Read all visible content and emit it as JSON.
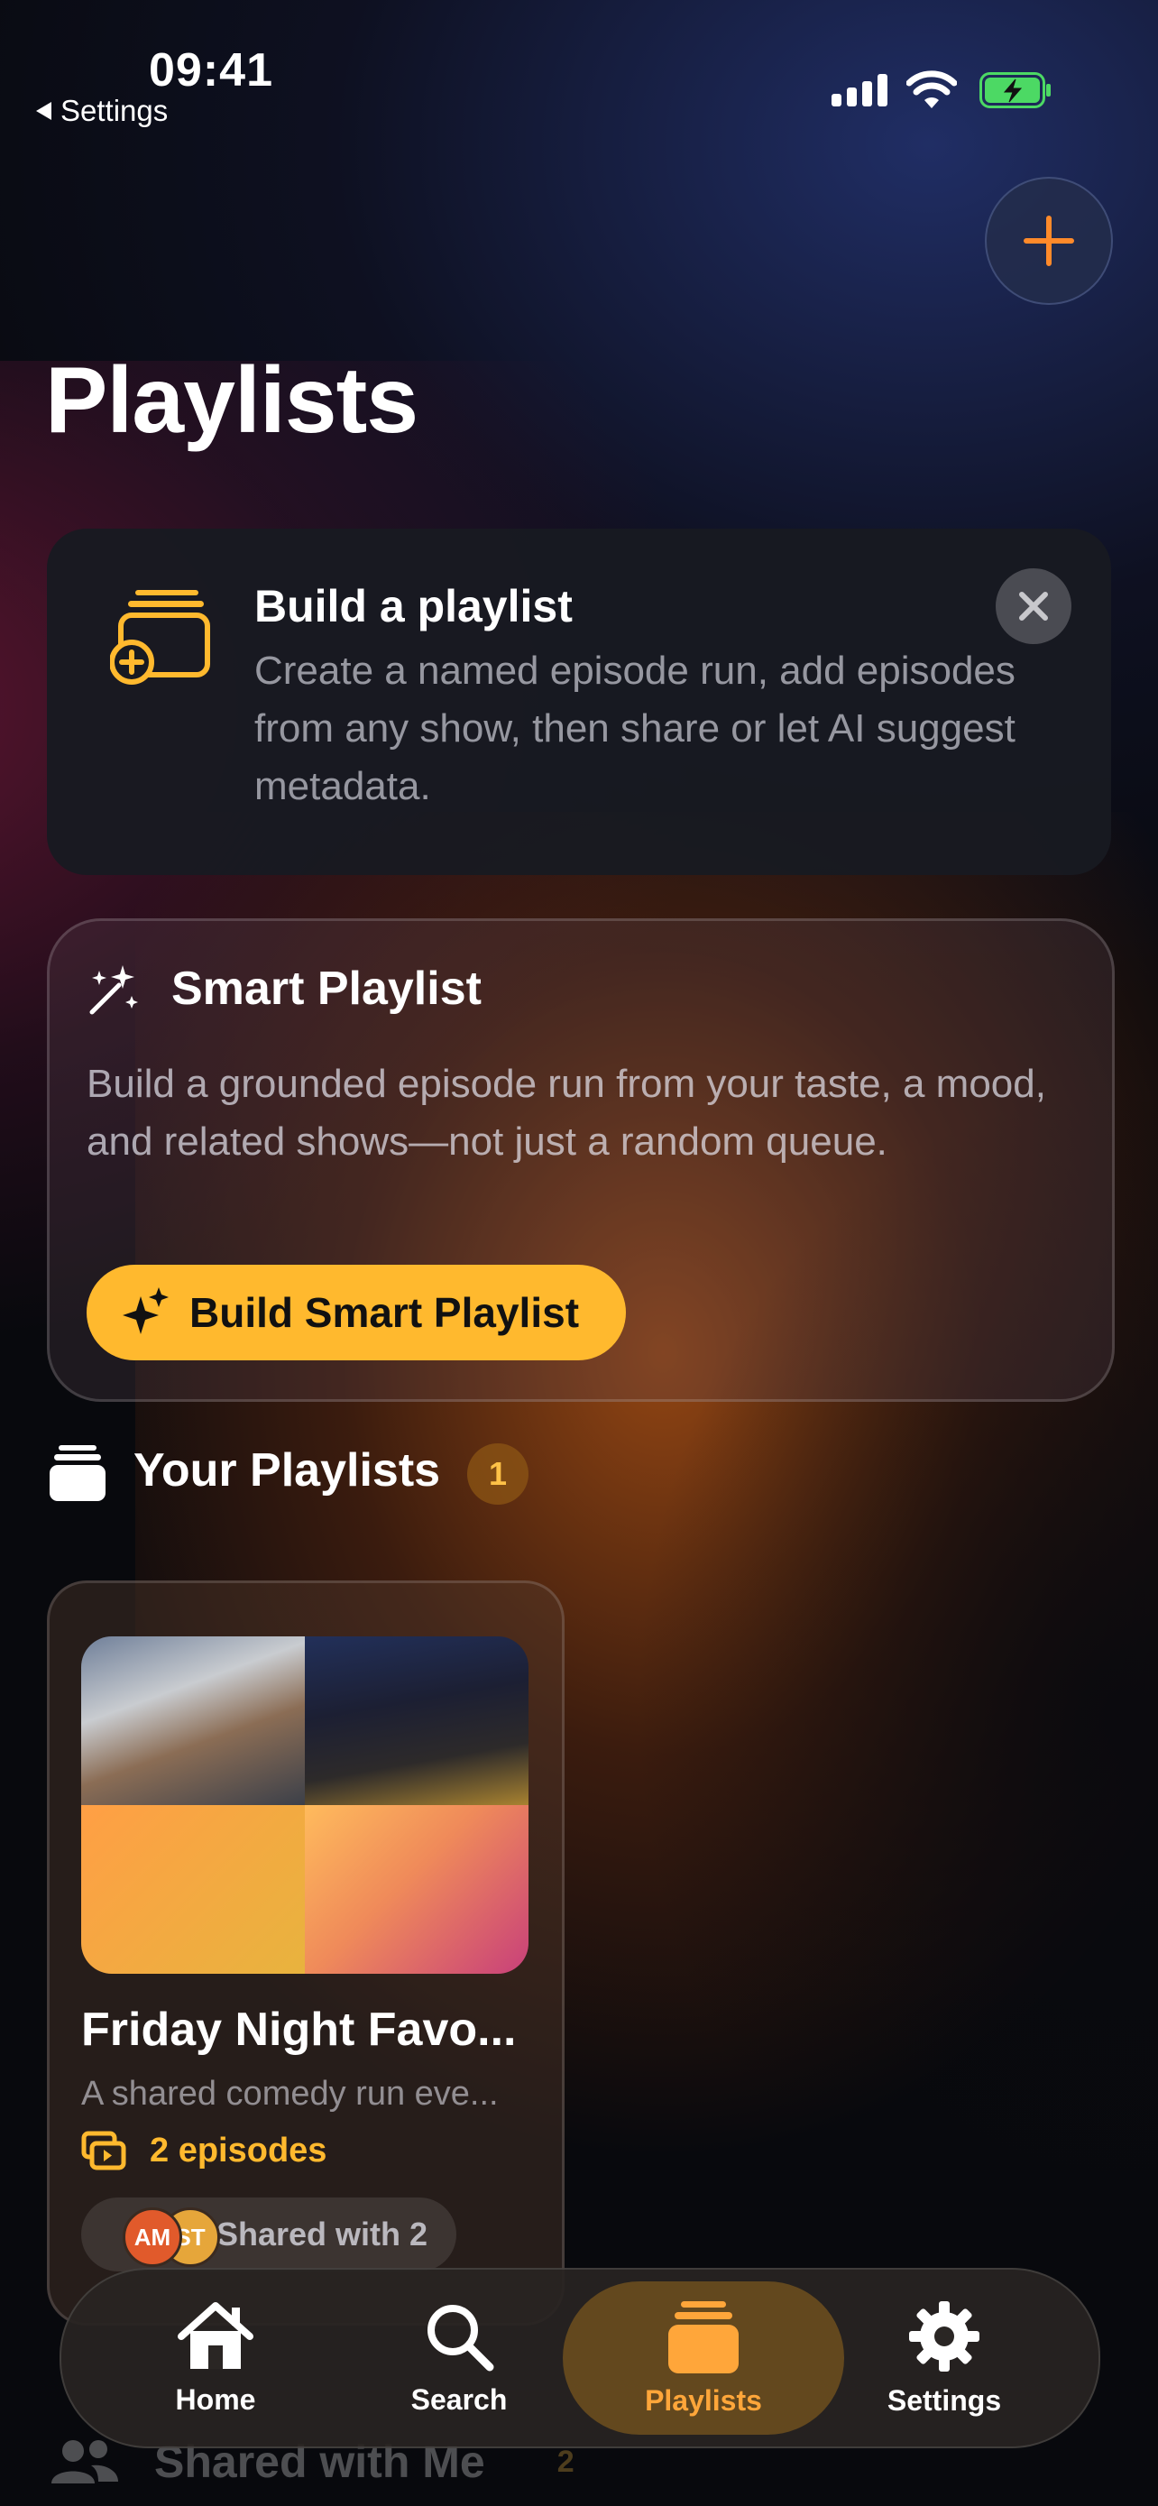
{
  "status_bar": {
    "time": "09:41",
    "back_label": "Settings"
  },
  "header": {
    "title": "Playlists",
    "add_icon": "plus-icon"
  },
  "tip_card": {
    "icon": "playlist-add-icon",
    "title": "Build a playlist",
    "body": "Create a named episode run, add episodes from any show, then share or let AI suggest metadata.",
    "close_icon": "close-icon"
  },
  "smart_playlist": {
    "icon": "magic-wand-icon",
    "title": "Smart Playlist",
    "body": "Build a grounded episode run from your taste, a mood, and related shows—not just a random queue.",
    "button_label": "Build Smart Playlist",
    "button_icon": "sparkles-icon"
  },
  "your_playlists": {
    "title": "Your Playlists",
    "count": "1",
    "items": [
      {
        "title": "Friday Night Favo...",
        "description": "A shared comedy run eve...",
        "episodes": "2 episodes",
        "shared_label": "Shared with 2",
        "avatars": [
          "AM",
          "ST"
        ]
      }
    ]
  },
  "shared_with_me": {
    "title": "Shared with Me",
    "count": "2"
  },
  "tab_bar": {
    "items": [
      {
        "label": "Home",
        "icon": "house-icon"
      },
      {
        "label": "Search",
        "icon": "magnifier-icon"
      },
      {
        "label": "Playlists",
        "icon": "playlists-stack-icon",
        "active": true
      },
      {
        "label": "Settings",
        "icon": "gear-icon"
      }
    ]
  },
  "colors": {
    "accent": "#ffb92e",
    "tab_active": "#ffa63a",
    "add_icon": "#ff8a2a"
  }
}
